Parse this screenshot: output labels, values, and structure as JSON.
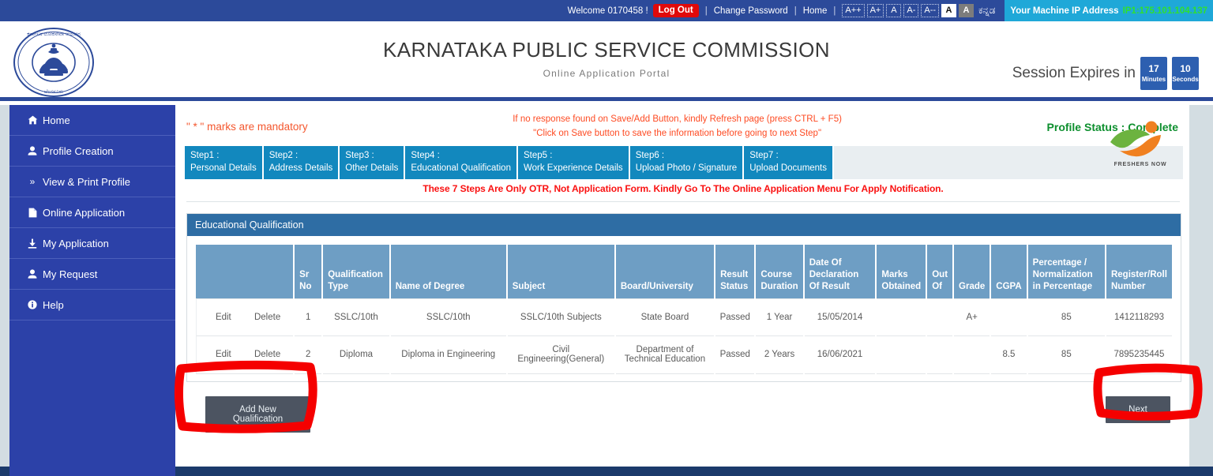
{
  "topbar": {
    "welcome": "Welcome 0170458 !",
    "logout_label": "Log Out",
    "change_password_label": "Change Password",
    "home_label": "Home",
    "separator": "|",
    "font_buttons": [
      "A++",
      "A+",
      "A",
      "A-",
      "A--"
    ],
    "contrast_buttons": [
      "A",
      "A"
    ],
    "kannada_label": "ಕನ್ನಡ",
    "ip_label": "Your Machine IP Address",
    "ip_value": "IP1:175.101.104.137",
    "colors": {
      "bar": "#2c4a9a",
      "logout": "#e0090a",
      "ip_box": "#1fa8d8",
      "ip_value": "#2fe02f"
    }
  },
  "header": {
    "title": "KARNATAKA PUBLIC SERVICE COMMISSION",
    "subtitle": "Online Application Portal",
    "emblem_name": "kpsc-seal",
    "session_label": "Session Expires in",
    "session_minutes": "17",
    "session_minutes_unit": "Minutes",
    "session_seconds": "10",
    "session_seconds_unit": "Seconds"
  },
  "sidebar": {
    "items": [
      {
        "label": "Home",
        "icon": "house-icon",
        "glyph": "⌂"
      },
      {
        "label": "Profile Creation",
        "icon": "user-icon",
        "glyph": "♟"
      },
      {
        "label": "View & Print Profile",
        "icon": "chevron-double-right-icon",
        "glyph": "»"
      },
      {
        "label": "Online Application",
        "icon": "file-icon",
        "glyph": "❐"
      },
      {
        "label": "My Application",
        "icon": "download-icon",
        "glyph": "⤓"
      },
      {
        "label": "My Request",
        "icon": "user-icon",
        "glyph": "♟"
      },
      {
        "label": "Help",
        "icon": "info-icon",
        "glyph": "ℹ"
      }
    ]
  },
  "notices": {
    "mandatory": "\" * \" marks are mandatory",
    "refresh_line1": "If no response found on Save/Add Button, kindly Refresh page (press CTRL + F5)",
    "refresh_line2": "\"Click on Save button to save the information before going to next Step\"",
    "profile_status": "Profile Status : Complete",
    "steps_note": "These 7 Steps Are Only OTR, Not Application Form. Kindly Go To The Online Application Menu For Apply Notification."
  },
  "steps": [
    {
      "num": "Step1 :",
      "label": "Personal Details"
    },
    {
      "num": "Step2 :",
      "label": "Address Details"
    },
    {
      "num": "Step3 :",
      "label": "Other Details"
    },
    {
      "num": "Step4 :",
      "label": "Educational Qualification"
    },
    {
      "num": "Step5 :",
      "label": "Work Experience Details"
    },
    {
      "num": "Step6 :",
      "label": "Upload Photo / Signature"
    },
    {
      "num": "Step7 :",
      "label": "Upload Documents"
    }
  ],
  "watermark": {
    "name": "freshers-now-logo",
    "text": "FRESHERS NOW"
  },
  "panel": {
    "title": "Educational Qualification",
    "columns": [
      "",
      "Sr No",
      "Qualification Type",
      "Name of Degree",
      "Subject",
      "Board/University",
      "Result Status",
      "Course Duration",
      "Date Of Declaration Of Result",
      "Marks Obtained",
      "Out Of",
      "Grade",
      "CGPA",
      "Percentage / Normalization in Percentage",
      "Register/Roll Number"
    ],
    "row_actions": {
      "edit": "Edit",
      "delete": "Delete"
    },
    "rows": [
      {
        "sr_no": "1",
        "qualification_type": "SSLC/10th",
        "name_of_degree": "SSLC/10th",
        "subject": "SSLC/10th Subjects",
        "board_university": "State Board",
        "result_status": "Passed",
        "course_duration": "1 Year",
        "date_of_result": "15/05/2014",
        "marks_obtained": "",
        "out_of": "",
        "grade": "A+",
        "cgpa": "",
        "percentage": "85",
        "register_number": "1412118293"
      },
      {
        "sr_no": "2",
        "qualification_type": "Diploma",
        "name_of_degree": "Diploma in Engineering",
        "subject": "Civil Engineering(General)",
        "board_university": "Department of Technical Education",
        "result_status": "Passed",
        "course_duration": "2 Years",
        "date_of_result": "16/06/2021",
        "marks_obtained": "",
        "out_of": "",
        "grade": "",
        "cgpa": "8.5",
        "percentage": "85",
        "register_number": "7895235445"
      }
    ]
  },
  "buttons": {
    "add_new_qualification": "Add New Qualification",
    "next": "Next"
  },
  "annotations": {
    "color": "#f50000",
    "shapes": [
      "rect-around-add-new-qualification",
      "rect-around-next"
    ]
  }
}
